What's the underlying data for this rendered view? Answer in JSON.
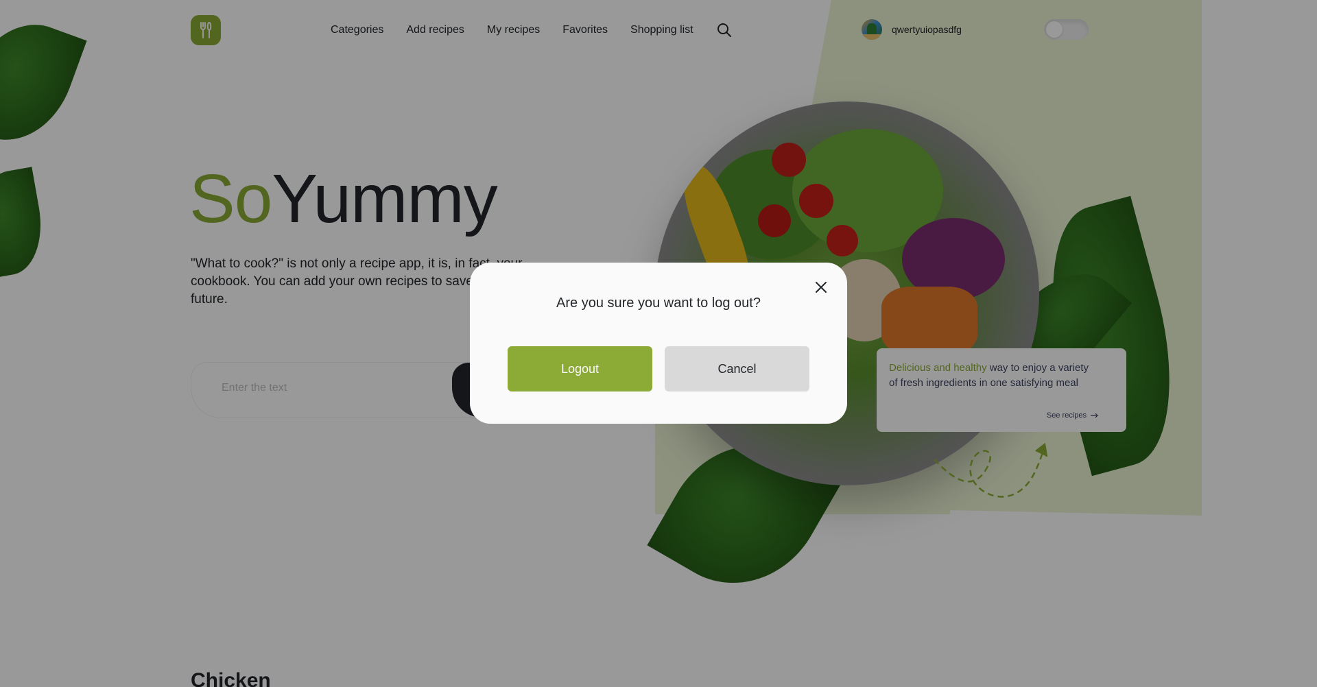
{
  "header": {
    "logo_icon": "fork-knife-icon",
    "nav": [
      {
        "label": "Categories"
      },
      {
        "label": "Add recipes"
      },
      {
        "label": "My recipes"
      },
      {
        "label": "Favorites"
      },
      {
        "label": "Shopping list"
      }
    ],
    "search_icon": "search-icon",
    "user_name": "qwertyuiopasdfg",
    "theme_toggle_on": false
  },
  "hero": {
    "title_accent": "So",
    "title_main": "Yummy",
    "description": "\"What to cook?\" is not only a recipe app, it is, in fact, your cookbook. You can add your own recipes to save them for the future.",
    "search_placeholder": "Enter the text"
  },
  "info_card": {
    "accent_text": "Delicious and healthy",
    "text": " way to enjoy a variety of fresh ingredients in one satisfying meal",
    "link_label": "See recipes",
    "link_icon": "arrow-right-icon"
  },
  "section": {
    "title": "Chicken"
  },
  "modal": {
    "question": "Are you sure you want to log out?",
    "logout_label": "Logout",
    "cancel_label": "Cancel",
    "close_icon": "close-icon"
  },
  "colors": {
    "accent": "#8BAA36",
    "dark": "#22252A",
    "overlay": "rgba(0,0,0,0.4)"
  }
}
